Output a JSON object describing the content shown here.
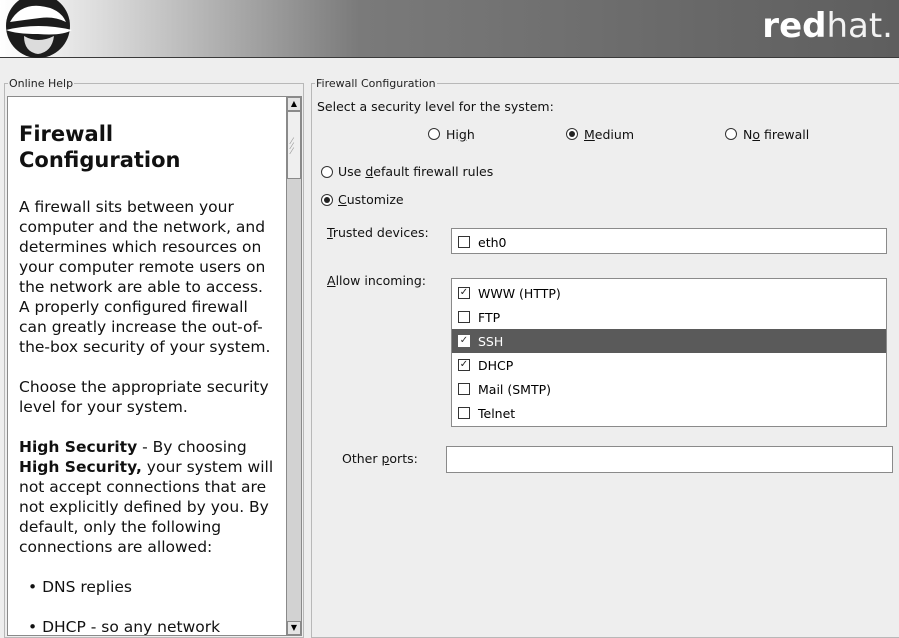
{
  "header": {
    "brand_bold": "red",
    "brand_light": "hat."
  },
  "help": {
    "legend": "Online Help",
    "title": "Firewall Configuration",
    "paragraphs": [
      "A firewall sits between your computer and the network, and determines which resources on your computer remote users on the network are able to access. A properly configured firewall can greatly increase the out-of-the-box security of your system.",
      "Choose the appropriate security level for your system."
    ],
    "high_bold1": "High Security",
    "high_mid": " - By choosing ",
    "high_bold2": "High Security,",
    "high_rest": " your system will not accept connections that are not explicitly defined by you. By default, only the following connections are allowed:",
    "bullets": [
      "• DNS replies",
      "• DHCP - so any network"
    ]
  },
  "config": {
    "legend": "Firewall Configuration",
    "security_prompt": "Select a security level for the system:",
    "levels": [
      {
        "label_pre": "Hi",
        "label_u": "g",
        "label_post": "h",
        "selected": false
      },
      {
        "label_pre": "",
        "label_u": "M",
        "label_post": "edium",
        "selected": true
      },
      {
        "label_pre": "N",
        "label_u": "o",
        "label_post": " firewall",
        "selected": false
      }
    ],
    "rules": [
      {
        "label_pre": "Use ",
        "label_u": "d",
        "label_post": "efault firewall rules",
        "selected": false
      },
      {
        "label_pre": "",
        "label_u": "C",
        "label_post": "ustomize",
        "selected": true
      }
    ],
    "trusted_label_u": "T",
    "trusted_label_rest": "rusted devices:",
    "trusted_devices": [
      {
        "name": "eth0",
        "checked": false
      }
    ],
    "incoming_label_u": "A",
    "incoming_label_rest": "llow incoming:",
    "incoming": [
      {
        "name": "WWW (HTTP)",
        "checked": true,
        "selected": false
      },
      {
        "name": "FTP",
        "checked": false,
        "selected": false
      },
      {
        "name": "SSH",
        "checked": true,
        "selected": true
      },
      {
        "name": "DHCP",
        "checked": true,
        "selected": false
      },
      {
        "name": "Mail (SMTP)",
        "checked": false,
        "selected": false
      },
      {
        "name": "Telnet",
        "checked": false,
        "selected": false
      }
    ],
    "other_ports_pre": "Other ",
    "other_ports_u": "p",
    "other_ports_post": "orts:",
    "other_ports_value": ""
  }
}
